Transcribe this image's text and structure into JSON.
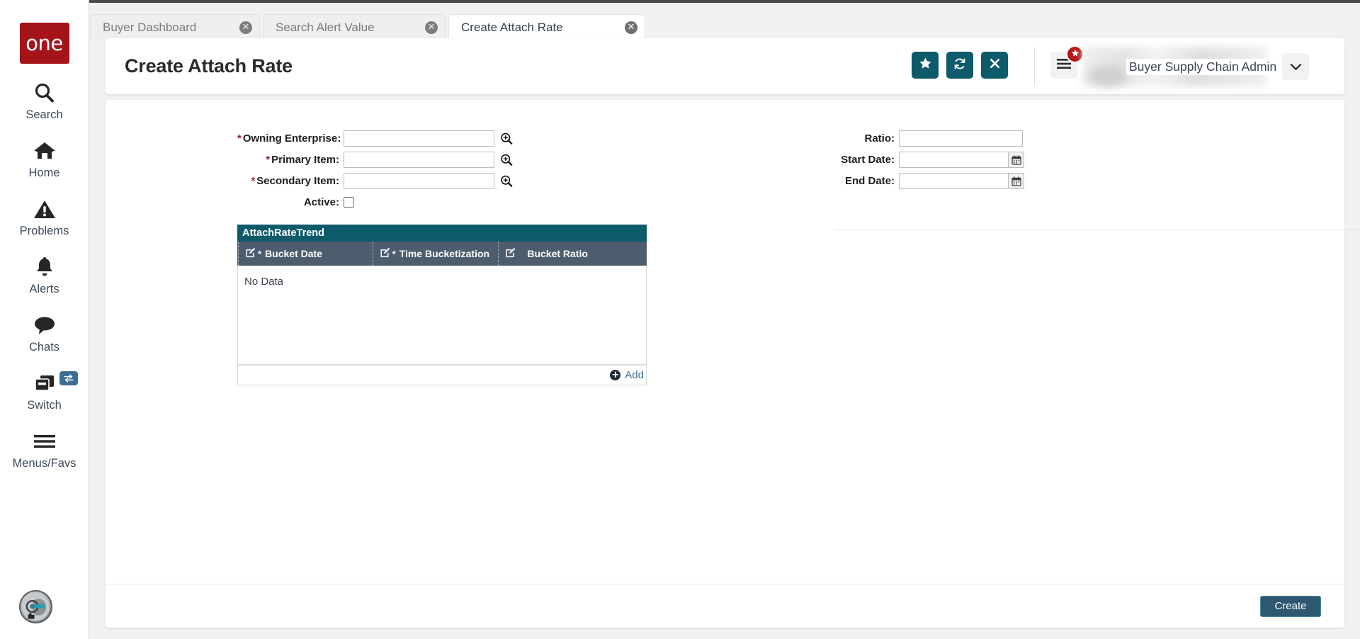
{
  "rail": {
    "brand": "one",
    "items": [
      {
        "label": "Search",
        "icon": "search-icon"
      },
      {
        "label": "Home",
        "icon": "home-icon"
      },
      {
        "label": "Problems",
        "icon": "warning-triangle-icon"
      },
      {
        "label": "Alerts",
        "icon": "bell-icon"
      },
      {
        "label": "Chats",
        "icon": "chat-bubble-icon"
      },
      {
        "label": "Switch",
        "icon": "windows-stack-icon",
        "badge_icon": "exchange-arrows-icon"
      },
      {
        "label": "Menus/Favs",
        "icon": "hamburger-icon"
      }
    ],
    "avatar_icon": "ai-assistant-avatar-icon"
  },
  "tabs": [
    {
      "label": "Buyer Dashboard",
      "active": false,
      "close_icon": "close-circle-icon"
    },
    {
      "label": "Search Alert Value",
      "active": false,
      "close_icon": "close-circle-icon"
    },
    {
      "label": "Create Attach Rate",
      "active": true,
      "close_icon": "close-circle-icon"
    }
  ],
  "header": {
    "title": "Create Attach Rate",
    "actions": [
      {
        "name": "favorite-button",
        "icon": "star-icon"
      },
      {
        "name": "refresh-button",
        "icon": "refresh-icon"
      },
      {
        "name": "close-button",
        "icon": "x-icon"
      }
    ],
    "menu_icon": "hamburger-icon",
    "menu_badge_icon": "star-icon",
    "user_name": "Buyer Supply Chain Admin",
    "caret_icon": "chevron-down-icon"
  },
  "form": {
    "left": [
      {
        "label": "Owning Enterprise",
        "required": true,
        "value": "",
        "placeholder": "",
        "picker_icon": "zoom-search-icon"
      },
      {
        "label": "Primary Item",
        "required": true,
        "value": "",
        "placeholder": "",
        "picker_icon": "zoom-search-icon"
      },
      {
        "label": "Secondary Item",
        "required": true,
        "value": "",
        "placeholder": "",
        "picker_icon": "zoom-search-icon"
      }
    ],
    "active": {
      "label": "Active",
      "checked": false
    },
    "right": [
      {
        "label": "Ratio",
        "required": false,
        "value": "",
        "placeholder": "",
        "calendar": false
      },
      {
        "label": "Start Date",
        "required": false,
        "value": "",
        "placeholder": "",
        "calendar": true,
        "calendar_icon": "calendar-icon"
      },
      {
        "label": "End Date",
        "required": false,
        "value": "",
        "placeholder": "",
        "calendar": true,
        "calendar_icon": "calendar-icon"
      }
    ]
  },
  "grid": {
    "title": "AttachRateTrend",
    "columns": [
      {
        "label": "Bucket Date",
        "required": true,
        "edit_icon": "edit-pencil-icon"
      },
      {
        "label": "Time Bucketization",
        "required": true,
        "edit_icon": "edit-pencil-icon"
      },
      {
        "label": "Bucket Ratio",
        "required": false,
        "edit_icon": "edit-pencil-icon"
      }
    ],
    "rows": [],
    "empty_text": "No Data",
    "add_label": "Add",
    "add_icon": "plus-circle-icon"
  },
  "footer": {
    "create_label": "Create"
  },
  "colors": {
    "brand_red": "#a41419",
    "teal": "#0d5a6b",
    "grid_header": "#4e5d6e",
    "create_button": "#2e5871",
    "required_star": "#a0242b",
    "link_blue": "#3d7396"
  }
}
